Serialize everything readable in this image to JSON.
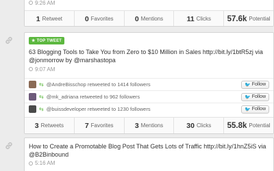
{
  "card1": {
    "time": "9:26 AM",
    "stats": [
      {
        "value": "1",
        "label": "Retweet"
      },
      {
        "value": "0",
        "label": "Favorites"
      },
      {
        "value": "0",
        "label": "Mentions"
      },
      {
        "value": "11",
        "label": "Clicks"
      },
      {
        "value": "57.6k",
        "label": "Potential"
      }
    ]
  },
  "card2": {
    "badge": "TOP TWEET",
    "line1": "63 Blogging Tools to Take You from Zero to $10 Million in Sales  http://bit.ly/1btR5zj via",
    "line2": "@jonmorrow by @marshastopa",
    "time": "9:07 AM",
    "retweets": [
      {
        "handle": "@AndreBisschop",
        "text": "retweeted to 1414 followers",
        "follow": "Follow",
        "color": "#8a6a55"
      },
      {
        "handle": "@mk_adriana",
        "text": "retweeted to 962 followers",
        "follow": "Follow",
        "color": "#6d5a7a"
      },
      {
        "handle": "@buissdeveloper",
        "text": "retweeted to 1230 followers",
        "follow": "Follow",
        "color": "#4a4a4a"
      }
    ],
    "stats": [
      {
        "value": "3",
        "label": "Retweets"
      },
      {
        "value": "7",
        "label": "Favorites"
      },
      {
        "value": "3",
        "label": "Mentions"
      },
      {
        "value": "30",
        "label": "Clicks"
      },
      {
        "value": "55.8k",
        "label": "Potential"
      }
    ]
  },
  "card3": {
    "line1": "How to Create a Promotable Blog Post That Gets Lots of Traffic http://bit.ly/1hnZ5iS via",
    "line2": "@B2Binbound",
    "time": "5:16 AM"
  }
}
